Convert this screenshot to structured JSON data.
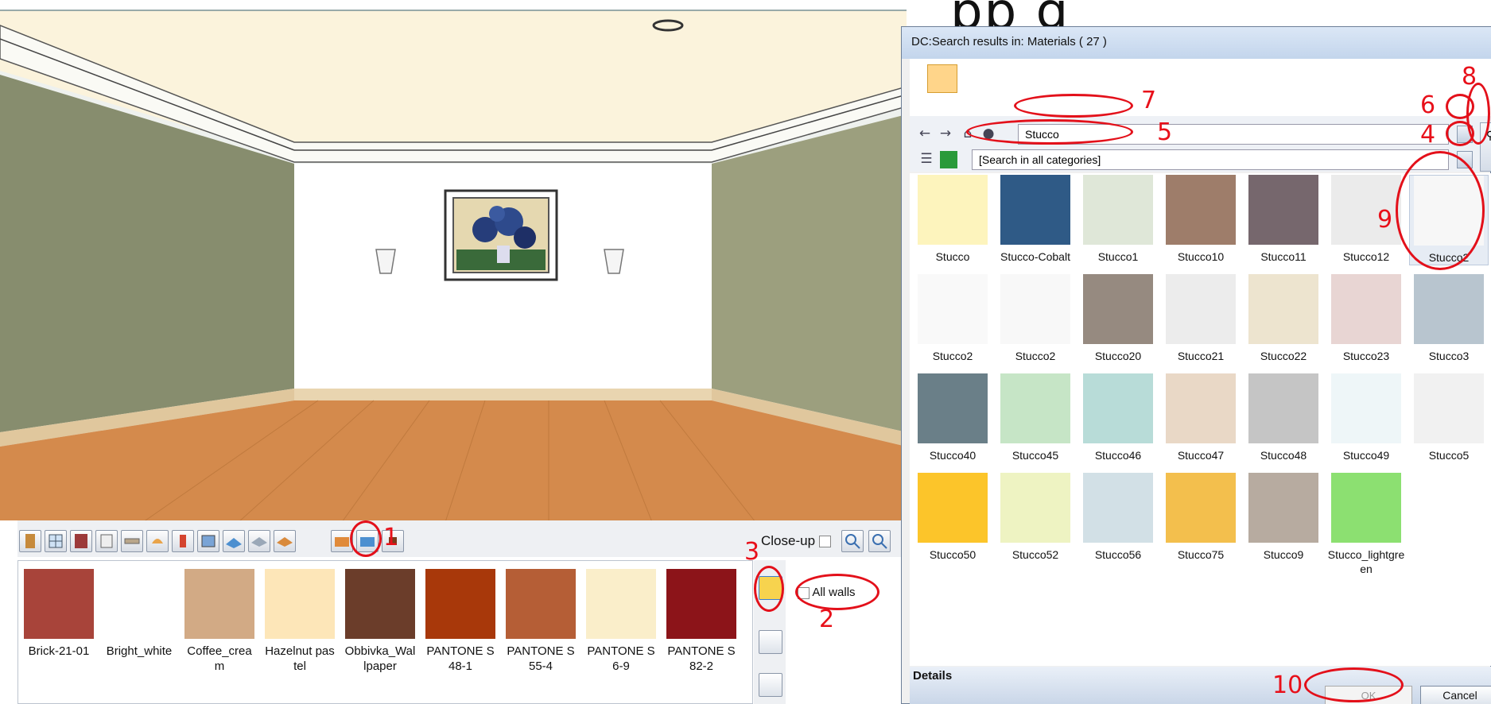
{
  "header_fragment": "pp       g",
  "toolbar": {
    "closeup_label": "Close-up",
    "buttons": [
      "door-icon",
      "window-icon",
      "cabinet-icon",
      "panel-icon",
      "shelf-icon",
      "lamp-icon",
      "wall-lamp-icon",
      "picture-icon",
      "floor-icon",
      "ceiling-icon",
      "wall-material-icon",
      "room-icon",
      "room-blue-icon",
      "brown-square-icon"
    ]
  },
  "materials": [
    {
      "label": "Brick-21-01",
      "color": "#a8443a"
    },
    {
      "label": "Bright_white",
      "color": "#ffffff"
    },
    {
      "label": "Coffee_cream",
      "color": "#d2aa85"
    },
    {
      "label": "Hazelnut pastel",
      "color": "#fde6b8"
    },
    {
      "label": "Obbivka_Wallpaper",
      "color": "#6b3d2a"
    },
    {
      "label": "PANTONE S 48-1",
      "color": "#a8380a"
    },
    {
      "label": "PANTONE S 55-4",
      "color": "#b55e36"
    },
    {
      "label": "PANTONE S 6-9",
      "color": "#faeeca"
    },
    {
      "label": "PANTONE S 82-2",
      "color": "#8c1419"
    }
  ],
  "all_walls_label": "All walls",
  "annotations": [
    "1",
    "2",
    "3",
    "4",
    "5",
    "6",
    "7",
    "8",
    "9",
    "10"
  ],
  "dialog": {
    "title": "DC:Search results in: Materials ( 27 )",
    "search_value": "Stucco",
    "category_value": "[Search in all categories]",
    "details_label": "Details",
    "ok_label": "OK",
    "cancel_label": "Cancel",
    "items": [
      {
        "label": "Stucco",
        "color": "#fdf4bd"
      },
      {
        "label": "Stucco-Cobalt",
        "color": "#2f5a86"
      },
      {
        "label": "Stucco1",
        "color": "#dfe7d8"
      },
      {
        "label": "Stucco10",
        "color": "#9e7d6a"
      },
      {
        "label": "Stucco11",
        "color": "#76676d"
      },
      {
        "label": "Stucco12",
        "color": "#ebebeb"
      },
      {
        "label": "Stucco2",
        "color": "#f7f7f7"
      },
      {
        "label": "Stucco2",
        "color": "#f9f9f9"
      },
      {
        "label": "Stucco2",
        "color": "#f8f8f8"
      },
      {
        "label": "Stucco20",
        "color": "#968a80"
      },
      {
        "label": "Stucco21",
        "color": "#ececec"
      },
      {
        "label": "Stucco22",
        "color": "#ede4cf"
      },
      {
        "label": "Stucco23",
        "color": "#e8d5d3"
      },
      {
        "label": "Stucco3",
        "color": "#b8c5cf"
      },
      {
        "label": "Stucco40",
        "color": "#6a7f88"
      },
      {
        "label": "Stucco45",
        "color": "#c6e5c6"
      },
      {
        "label": "Stucco46",
        "color": "#b8dcd8"
      },
      {
        "label": "Stucco47",
        "color": "#e9d8c6"
      },
      {
        "label": "Stucco48",
        "color": "#c5c5c5"
      },
      {
        "label": "Stucco49",
        "color": "#eef6f8"
      },
      {
        "label": "Stucco5",
        "color": "#f1f1f1"
      },
      {
        "label": "Stucco50",
        "color": "#fcc52a"
      },
      {
        "label": "Stucco52",
        "color": "#eef3c2"
      },
      {
        "label": "Stucco56",
        "color": "#d2e0e6"
      },
      {
        "label": "Stucco75",
        "color": "#f3bf4d"
      },
      {
        "label": "Stucco9",
        "color": "#b7aba0"
      },
      {
        "label": "Stucco_lightgreen",
        "color": "#8ce071"
      }
    ]
  }
}
